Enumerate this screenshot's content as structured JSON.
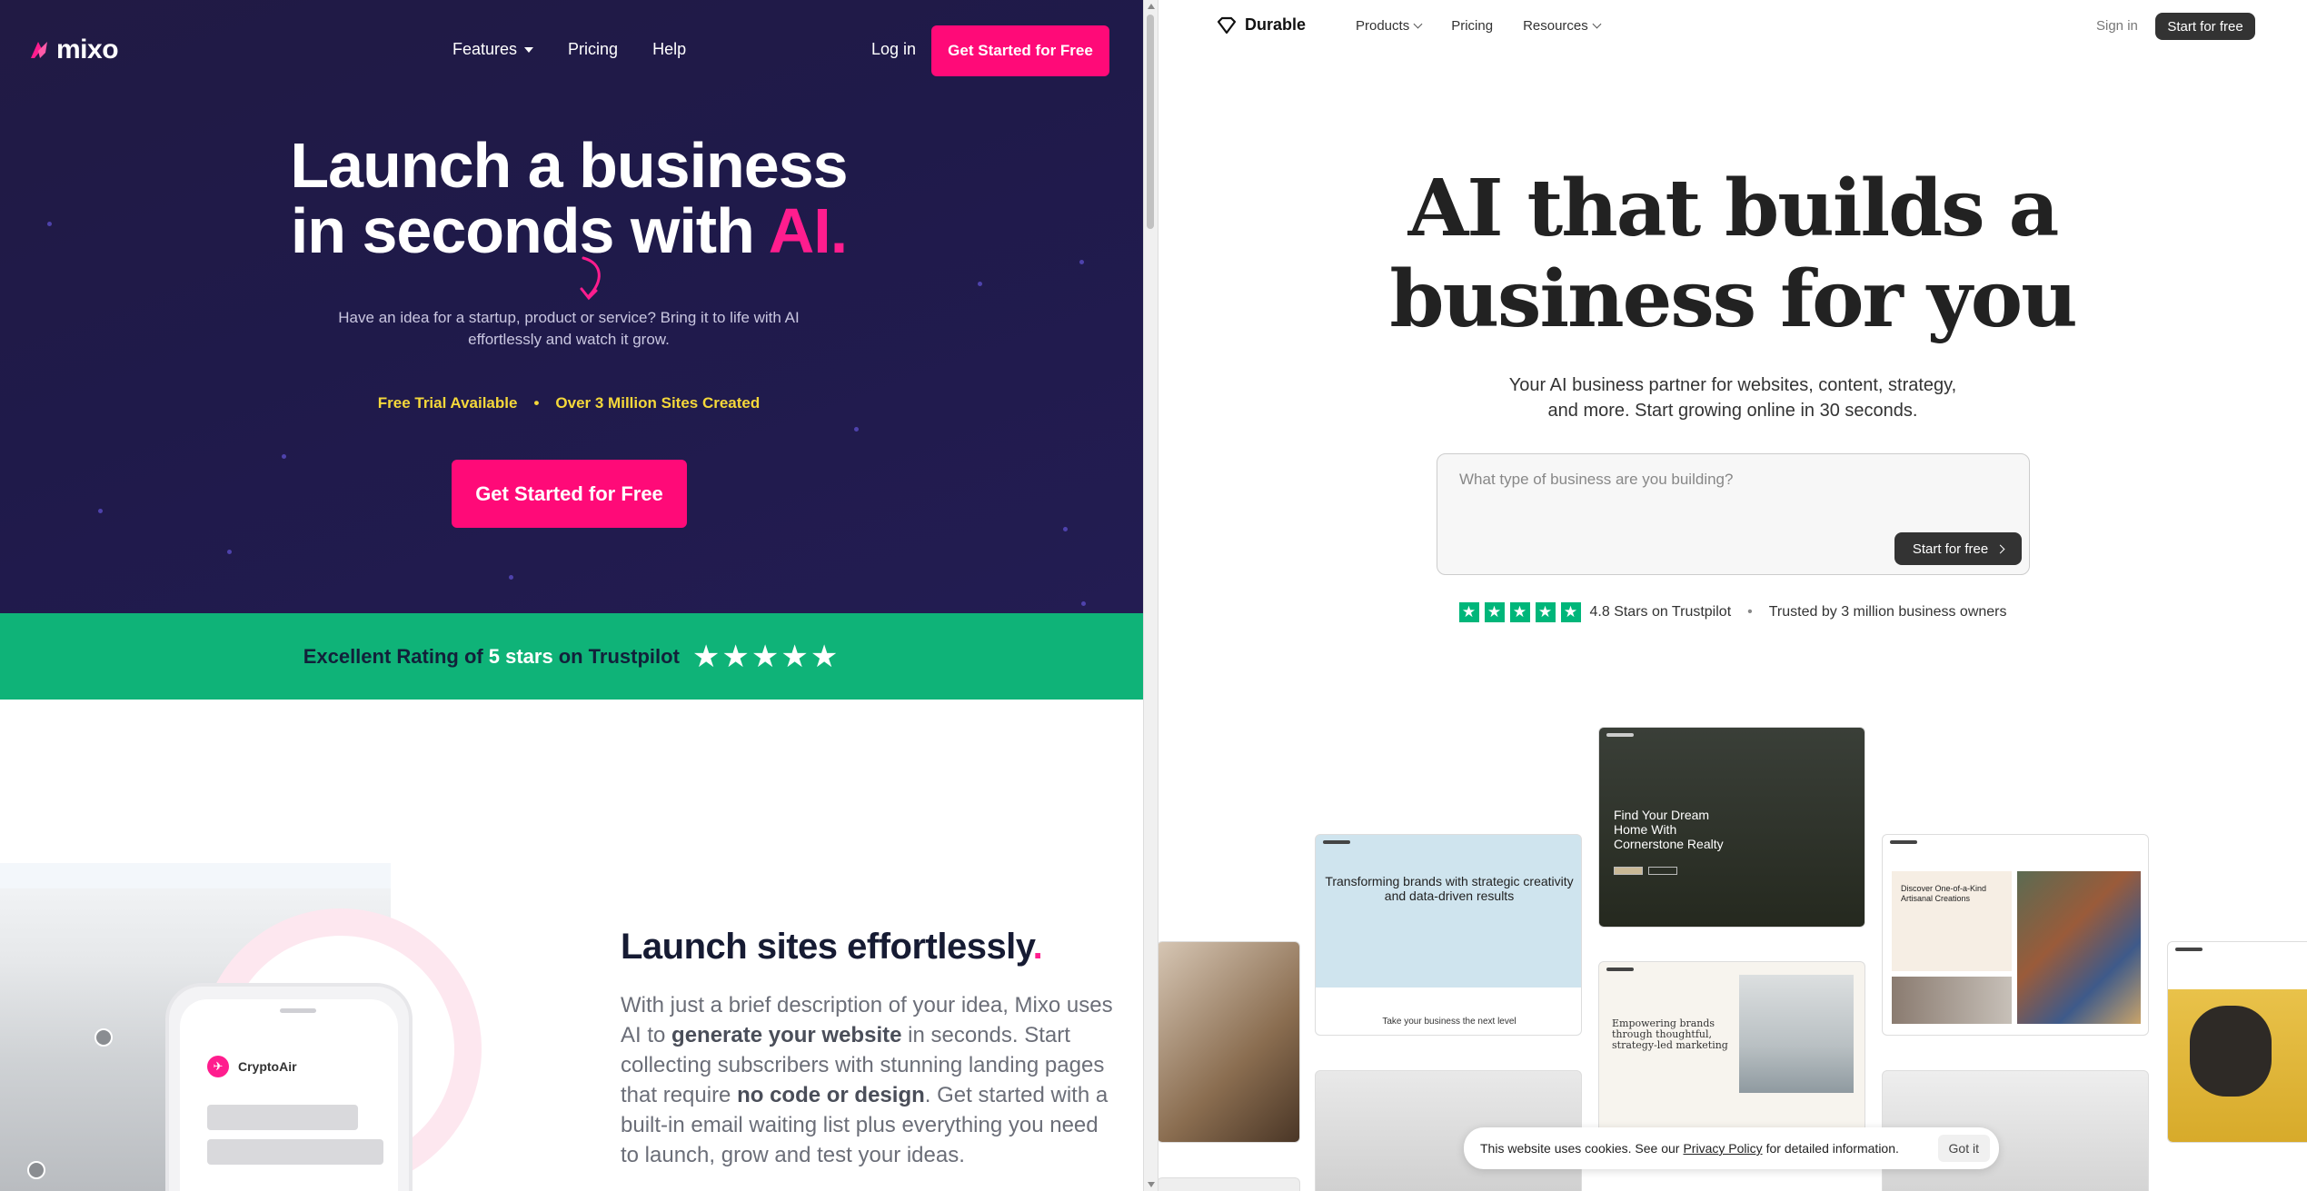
{
  "mixo": {
    "logo_text": "mixo",
    "nav": {
      "features": "Features",
      "pricing": "Pricing",
      "help": "Help"
    },
    "login": "Log in",
    "cta_top": "Get Started for Free",
    "headline_line1": "Launch a business",
    "headline_line2_pre": "in seconds with ",
    "headline_ai": "AI",
    "headline_period": ".",
    "subtitle": "Have an idea for a startup, product or service? Bring it to life with AI effortlessly and watch it grow.",
    "badge1": "Free Trial Available",
    "badge_sep": "•",
    "badge2": "Over 3 Million Sites Created",
    "cta_main": "Get Started for Free",
    "trust": {
      "pre": "Excellent Rating of ",
      "highlight": "5 stars",
      "post": " on Trustpilot",
      "stars": "★★★★★"
    },
    "section_title": "Launch sites effortlessly",
    "section_title_dot": ".",
    "section_p": {
      "s1": "With just a brief description of your idea, Mixo uses AI to ",
      "b1": "generate your website",
      "s2": " in seconds. Start collecting subscribers with stunning landing pages that require ",
      "b2": "no code or design",
      "s3": ". Get started with a built-in email waiting list plus everything you need to launch, grow and test your ideas."
    },
    "phone_brand": "CryptoAir",
    "colors": {
      "accent": "#ff0a78",
      "trust_green": "#0fb378",
      "badge_yellow": "#f5d83a",
      "hero_bg": "#211a44"
    }
  },
  "durable": {
    "logo_text": "Durable",
    "nav": {
      "products": "Products",
      "pricing": "Pricing",
      "resources": "Resources"
    },
    "signin": "Sign in",
    "start_top": "Start for free",
    "headline_line1": "AI that builds a",
    "headline_line2": "business for you",
    "subtitle_line1": "Your AI business partner for websites, content, strategy,",
    "subtitle_line2": "and more. Start growing online in 30 seconds.",
    "input_placeholder": "What type of business are you building?",
    "input_button": "Start for free",
    "rating_text": "4.8 Stars on Trustpilot",
    "rating_sep": "•",
    "trusted_text": "Trusted by 3 million business owners",
    "thumbs": {
      "center_title": "Find Your Dream Home With Cornerstone Realty",
      "left_title": "Transforming brands with strategic creativity and data-driven results",
      "left_footer": "Take your business the next level",
      "right_title": "Discover One-of-a-Kind Artisanal Creations",
      "mid_title": "Empowering brands through thoughtful, strategy-led marketing"
    },
    "cookie": {
      "pre": "This website uses cookies. See our ",
      "link": "Privacy Policy",
      "post": " for detailed information.",
      "button": "Got it"
    },
    "colors": {
      "trustpilot": "#00b67a",
      "dark_button": "#333333"
    }
  }
}
